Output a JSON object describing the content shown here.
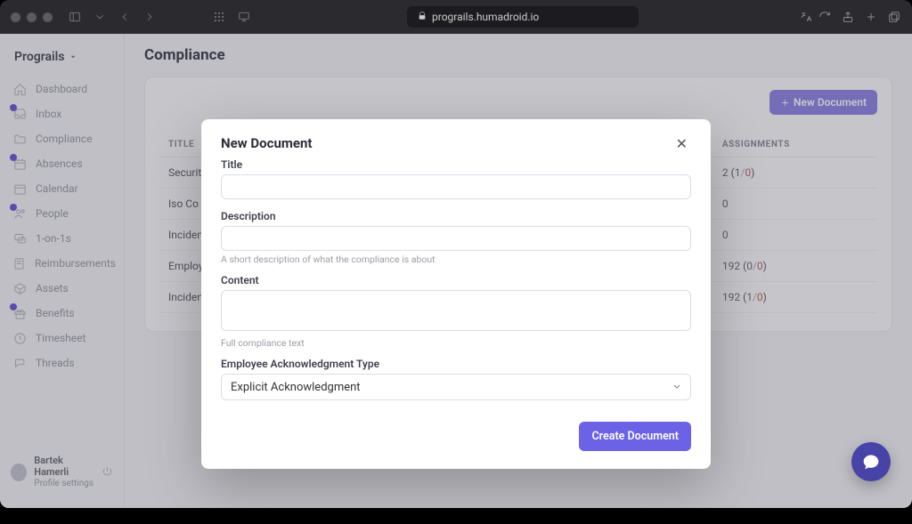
{
  "browser": {
    "url_host": "prograils.humadroid.io"
  },
  "org": {
    "name": "Prograils"
  },
  "sidebar": {
    "items": [
      {
        "label": "Dashboard",
        "icon": "home",
        "badge": false
      },
      {
        "label": "Inbox",
        "icon": "inbox",
        "badge": true
      },
      {
        "label": "Compliance",
        "icon": "folder",
        "badge": false
      },
      {
        "label": "Absences",
        "icon": "calendar",
        "badge": true
      },
      {
        "label": "Calendar",
        "icon": "calendar2",
        "badge": false
      },
      {
        "label": "People",
        "icon": "users",
        "badge": true
      },
      {
        "label": "1-on-1s",
        "icon": "chat",
        "badge": false
      },
      {
        "label": "Reimbursements",
        "icon": "receipt",
        "badge": false
      },
      {
        "label": "Assets",
        "icon": "box",
        "badge": false
      },
      {
        "label": "Benefits",
        "icon": "gift",
        "badge": true
      },
      {
        "label": "Timesheet",
        "icon": "clock",
        "badge": false
      },
      {
        "label": "Threads",
        "icon": "threads",
        "badge": false
      }
    ]
  },
  "user": {
    "name": "Bartek Hamerli",
    "subtitle": "Profile settings"
  },
  "page": {
    "title": "Compliance"
  },
  "toolbar": {
    "new_document": "New Document"
  },
  "table": {
    "headers": {
      "title": "TITLE",
      "assignments": "ASSIGNMENTS"
    },
    "rows": [
      {
        "title": "Security",
        "assign_total": "2",
        "assign_done": "1",
        "assign_zero": "0"
      },
      {
        "title": "Iso Co",
        "assign_total": "0",
        "assign_done": "",
        "assign_zero": ""
      },
      {
        "title": "Incident",
        "assign_total": "0",
        "assign_done": "",
        "assign_zero": ""
      },
      {
        "title": "Employee",
        "assign_total": "192",
        "assign_done": "0",
        "assign_zero": "0"
      },
      {
        "title": "Incident",
        "assign_total": "192",
        "assign_done": "1",
        "assign_zero": "0"
      }
    ]
  },
  "modal": {
    "title": "New Document",
    "labels": {
      "title": "Title",
      "description": "Description",
      "content": "Content",
      "ack_type": "Employee Acknowledgment Type"
    },
    "help": {
      "description": "A short description of what the compliance is about",
      "content": "Full compliance text"
    },
    "ack_selected": "Explicit Acknowledgment",
    "submit": "Create Document"
  }
}
